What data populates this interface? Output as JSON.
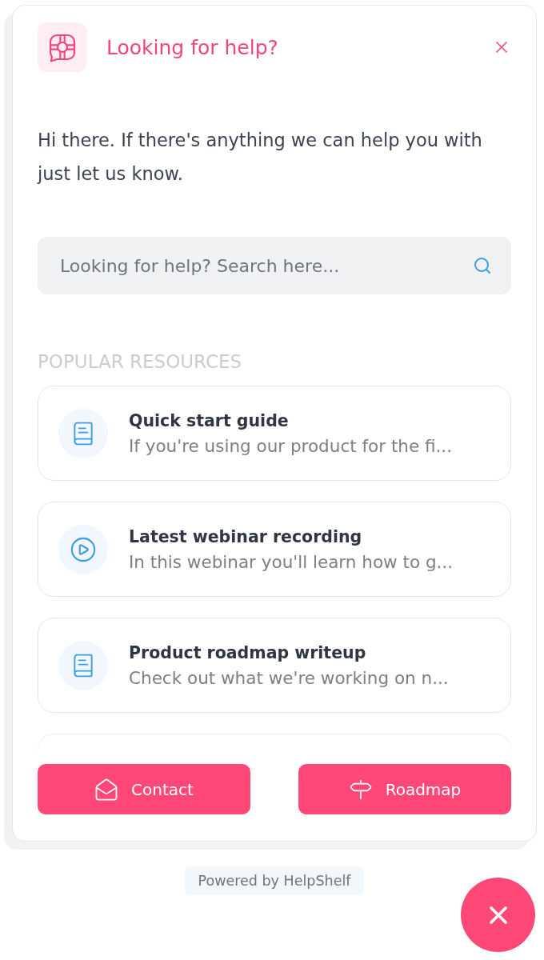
{
  "header": {
    "title": "Looking for help?"
  },
  "intro": "Hi there. If there's anything we can help you with just let us know.",
  "search": {
    "placeholder": "Looking for help? Search here..."
  },
  "resources": {
    "heading": "POPULAR RESOURCES",
    "items": [
      {
        "kind": "document",
        "title": "Quick start guide",
        "description": "If you're using our product for the fi..."
      },
      {
        "kind": "video",
        "title": "Latest webinar recording",
        "description": "In this webinar you'll learn how to g..."
      },
      {
        "kind": "document",
        "title": "Product roadmap writeup",
        "description": "Check out what we're working on n..."
      }
    ]
  },
  "actions": [
    {
      "kind": "contact",
      "label": "Contact"
    },
    {
      "kind": "roadmap",
      "label": "Roadmap"
    }
  ],
  "footer": {
    "powered_by": "Powered by HelpShelf"
  }
}
